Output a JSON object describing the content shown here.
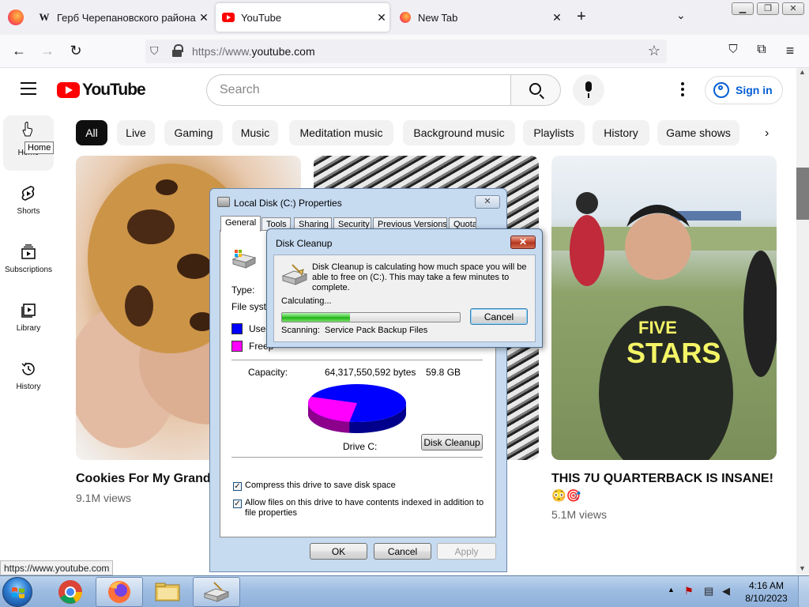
{
  "browser": {
    "tabs": [
      {
        "title": "Герб Черепановского района",
        "icon": "wikipedia-icon"
      },
      {
        "title": "YouTube",
        "icon": "youtube-icon",
        "active": true
      },
      {
        "title": "New Tab",
        "icon": "firefox-icon"
      }
    ],
    "url_host": "https://www.",
    "url_domain": "youtube.com",
    "status_url": "https://www.youtube.com"
  },
  "youtube": {
    "logo_text": "YouTube",
    "search_placeholder": "Search",
    "sign_in": "Sign in",
    "chips": [
      "All",
      "Live",
      "Gaming",
      "Music",
      "Meditation music",
      "Background music",
      "Playlists",
      "History",
      "Game shows"
    ],
    "sidebar": [
      {
        "label": "Home",
        "icon": "home-icon"
      },
      {
        "label": "Shorts",
        "icon": "shorts-icon"
      },
      {
        "label": "Subscriptions",
        "icon": "subscriptions-icon"
      },
      {
        "label": "Library",
        "icon": "library-icon"
      },
      {
        "label": "History",
        "icon": "history-icon"
      }
    ],
    "tooltip": "Home",
    "videos": [
      {
        "title": "Cookies For My Grandm",
        "views": "9.1M views"
      },
      {
        "title": "THIS 7U QUARTERBACK IS INSANE!",
        "emoji": "😳🎯",
        "views": "5.1M views"
      }
    ]
  },
  "properties_dialog": {
    "title": "Local Disk (C:) Properties",
    "tabs": [
      "General",
      "Tools",
      "Sharing",
      "Security",
      "Previous Versions",
      "Quota"
    ],
    "type_label": "Type:",
    "fs_label": "File syste",
    "used_label": "Used",
    "free_label": "Freep",
    "capacity_label": "Capacity:",
    "capacity_bytes": "64,317,550,592 bytes",
    "capacity_gb": "59.8 GB",
    "drive_label": "Drive C:",
    "disk_cleanup_btn": "Disk Cleanup",
    "compress_label": "Compress this drive to save disk space",
    "index_label": "Allow files on this drive to have contents indexed in addition to file properties",
    "ok": "OK",
    "cancel": "Cancel",
    "apply": "Apply",
    "used_fraction": 0.28,
    "colors": {
      "used": "#0000ff",
      "free": "#ff00ff"
    }
  },
  "cleanup_dialog": {
    "title": "Disk Cleanup",
    "message": "Disk Cleanup is calculating how much space you will be able to free on  (C:). This may take a few minutes to complete.",
    "calculating": "Calculating...",
    "progress": 0.38,
    "cancel": "Cancel",
    "scanning_label": "Scanning:",
    "scanning_item": "Service Pack Backup Files"
  },
  "taskbar": {
    "time": "4:16 AM",
    "date": "8/10/2023",
    "apps": [
      "chrome-icon",
      "firefox-icon",
      "explorer-icon",
      "disk-cleanup-icon"
    ]
  }
}
